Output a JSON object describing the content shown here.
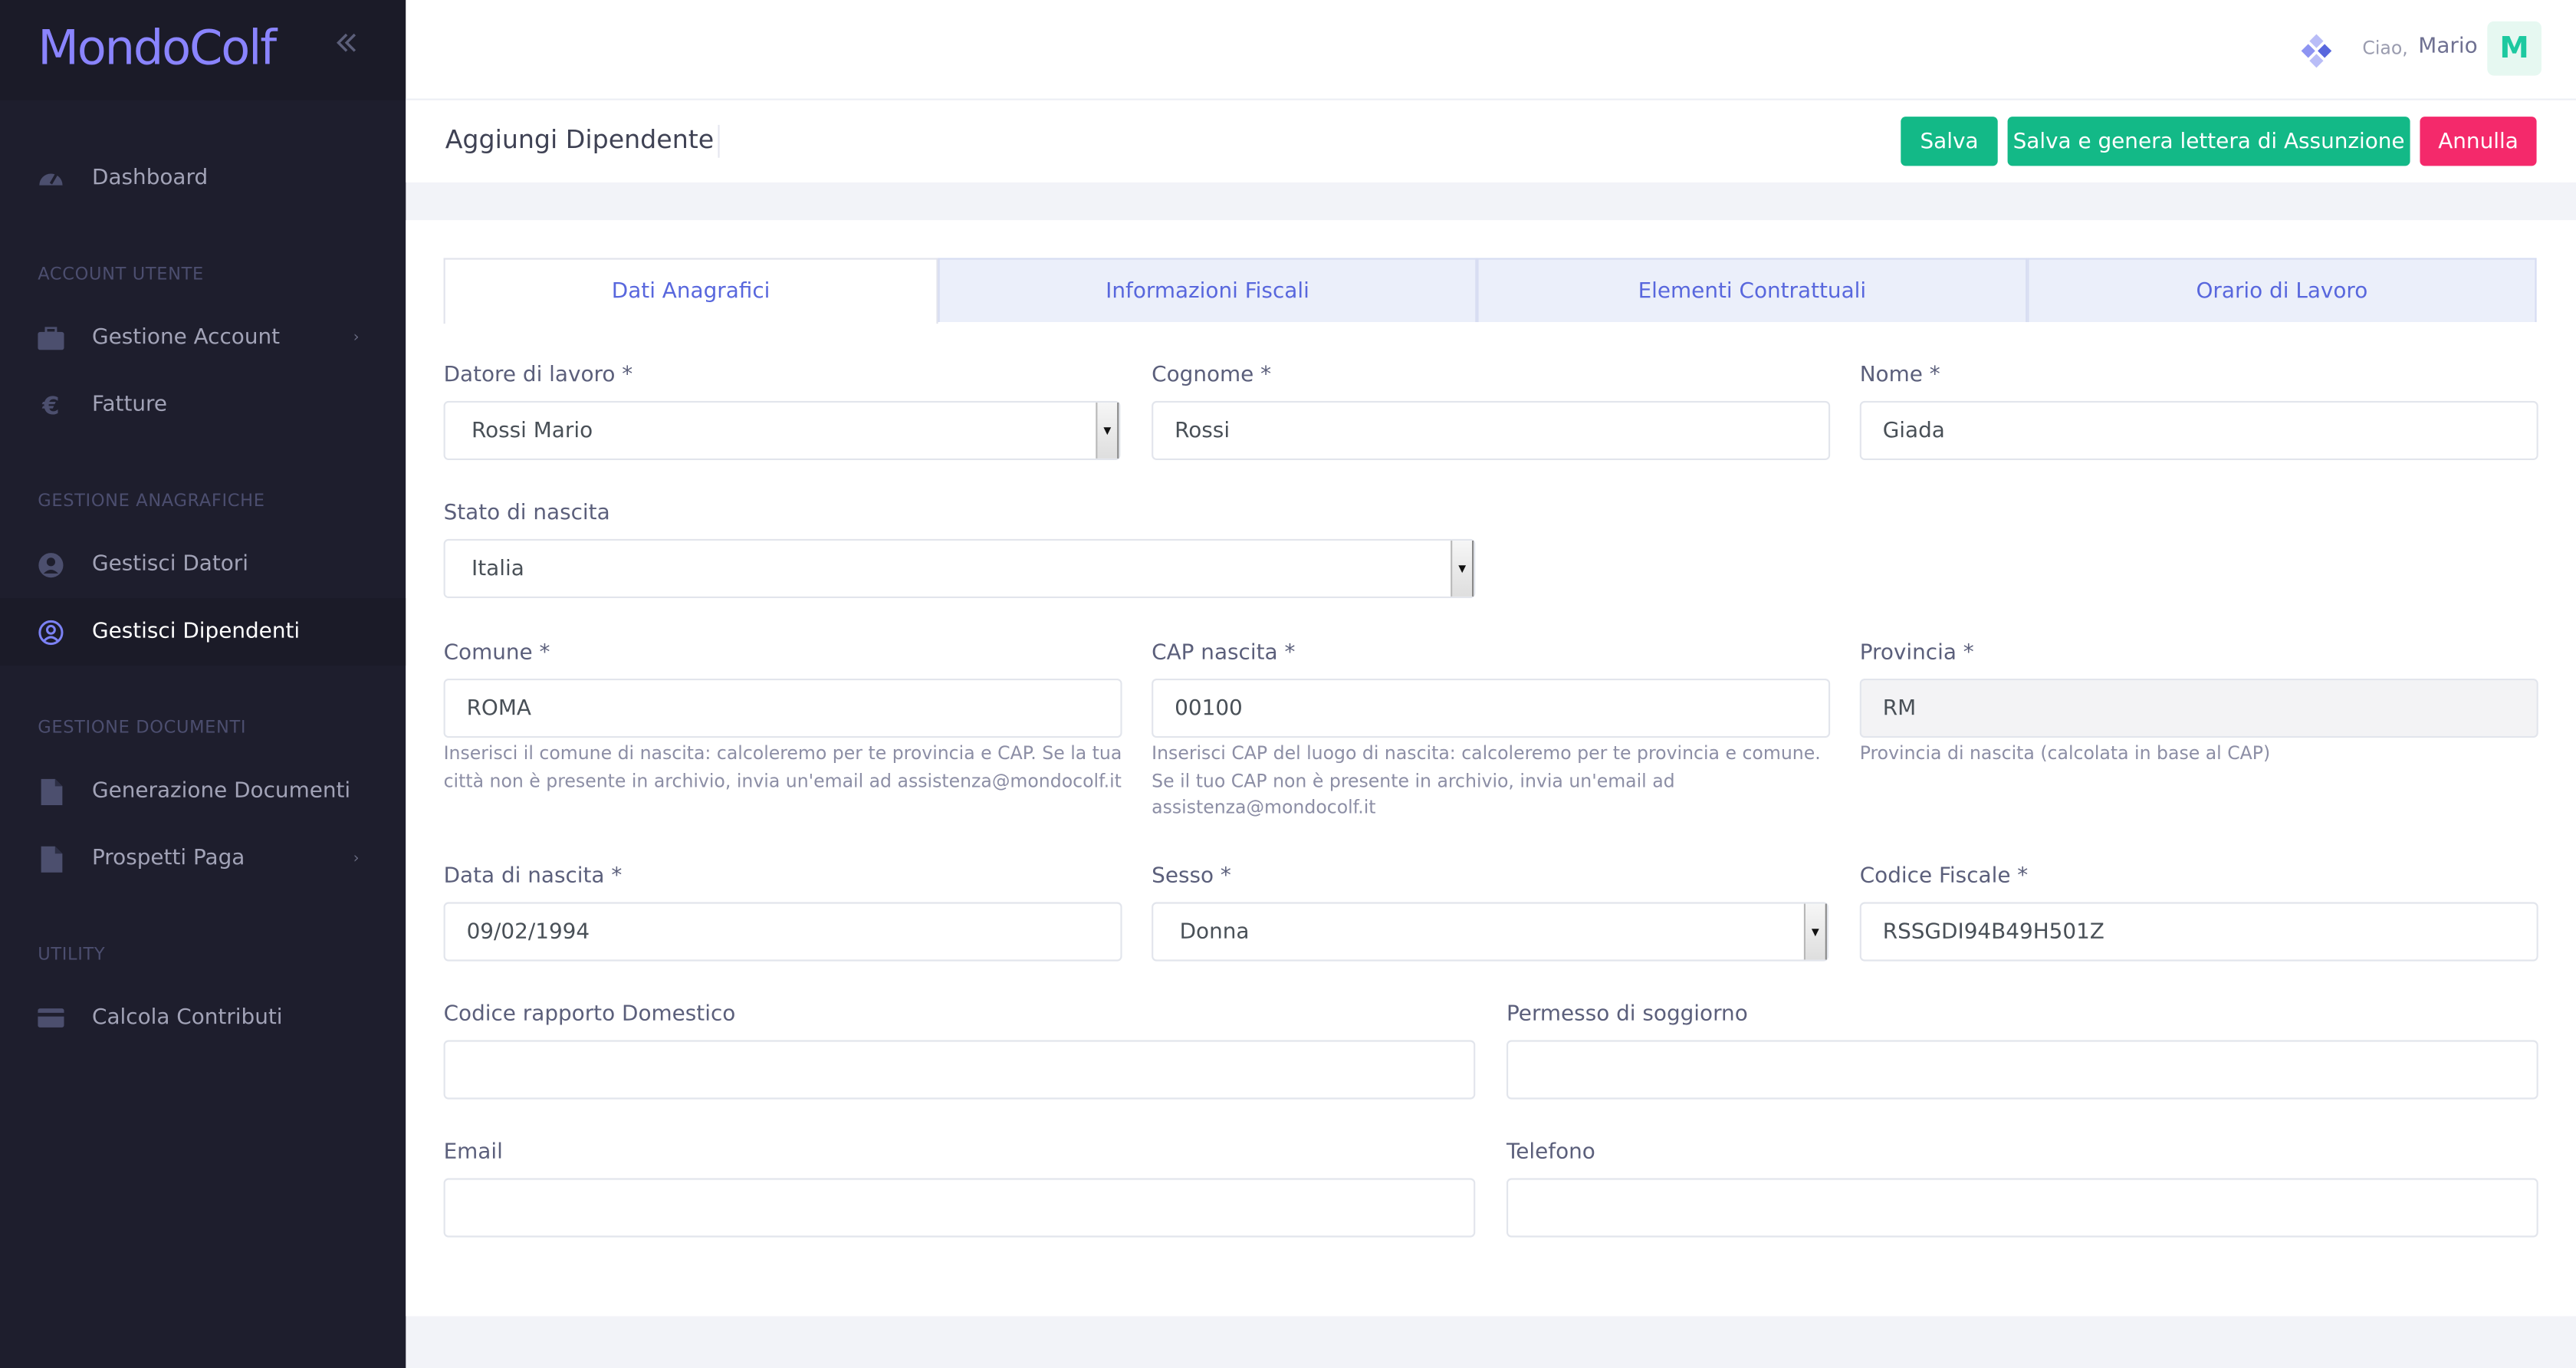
{
  "app": {
    "logo_text": "MondoColf",
    "brand_color": "#8a84ff",
    "collapse_icon": "chevrons-left-icon"
  },
  "user": {
    "greeting": "Ciao,",
    "name": "Mario",
    "avatar_letter": "M"
  },
  "sidebar": {
    "sections": [
      "ACCOUNT UTENTE",
      "GESTIONE ANAGRAFICHE",
      "GESTIONE DOCUMENTI",
      "UTILITY"
    ],
    "items": [
      {
        "label": "Dashboard",
        "icon": "gauge-icon"
      },
      {
        "label": "Gestione Account",
        "icon": "briefcase-icon",
        "has_submenu": true
      },
      {
        "label": "Fatture",
        "icon": "euro-icon"
      },
      {
        "label": "Gestisci Datori",
        "icon": "user-circle-icon"
      },
      {
        "label": "Gestisci Dipendenti",
        "icon": "user-circle-outline-icon",
        "active": true
      },
      {
        "label": "Generazione Documenti",
        "icon": "file-icon"
      },
      {
        "label": "Prospetti Paga",
        "icon": "file-icon",
        "has_submenu": true
      },
      {
        "label": "Calcola Contributi",
        "icon": "credit-card-icon"
      }
    ]
  },
  "page": {
    "title": "Aggiungi Dipendente",
    "buttons": {
      "save": "Salva",
      "save_generate": "Salva e genera lettera di Assunzione",
      "cancel": "Annulla"
    },
    "colors": {
      "primary_green": "#13b987",
      "danger_pink": "#f4296b",
      "tab_text": "#5867dd"
    }
  },
  "tabs": [
    "Dati Anagrafici",
    "Informazioni Fiscali",
    "Elementi Contrattuali",
    "Orario di Lavoro"
  ],
  "form": {
    "datore": {
      "label": "Datore di lavoro *",
      "value": "Rossi Mario"
    },
    "cognome": {
      "label": "Cognome *",
      "value": "Rossi"
    },
    "nome": {
      "label": "Nome *",
      "value": "Giada"
    },
    "stato_nascita": {
      "label": "Stato di nascita",
      "value": "Italia"
    },
    "comune": {
      "label": "Comune *",
      "value": "ROMA",
      "hint": "Inserisci il comune di nascita: calcoleremo per te provincia e CAP. Se la tua città non è presente in archivio, invia un'email ad assistenza@mondocolf.it"
    },
    "cap": {
      "label": "CAP nascita *",
      "value": "00100",
      "hint": "Inserisci CAP del luogo di nascita: calcoleremo per te provincia e comune. Se il tuo CAP non è presente in archivio, invia un'email ad assistenza@mondocolf.it"
    },
    "provincia": {
      "label": "Provincia *",
      "value": "RM",
      "hint": "Provincia di nascita (calcolata in base al CAP)"
    },
    "data_nascita": {
      "label": "Data di nascita *",
      "value": "09/02/1994"
    },
    "sesso": {
      "label": "Sesso *",
      "value": "Donna"
    },
    "codice_fiscale": {
      "label": "Codice Fiscale *",
      "value": "RSSGDI94B49H501Z"
    },
    "codice_rapporto": {
      "label": "Codice rapporto Domestico",
      "value": ""
    },
    "permesso": {
      "label": "Permesso di soggiorno",
      "value": ""
    },
    "email": {
      "label": "Email",
      "value": ""
    },
    "telefono": {
      "label": "Telefono",
      "value": ""
    }
  }
}
